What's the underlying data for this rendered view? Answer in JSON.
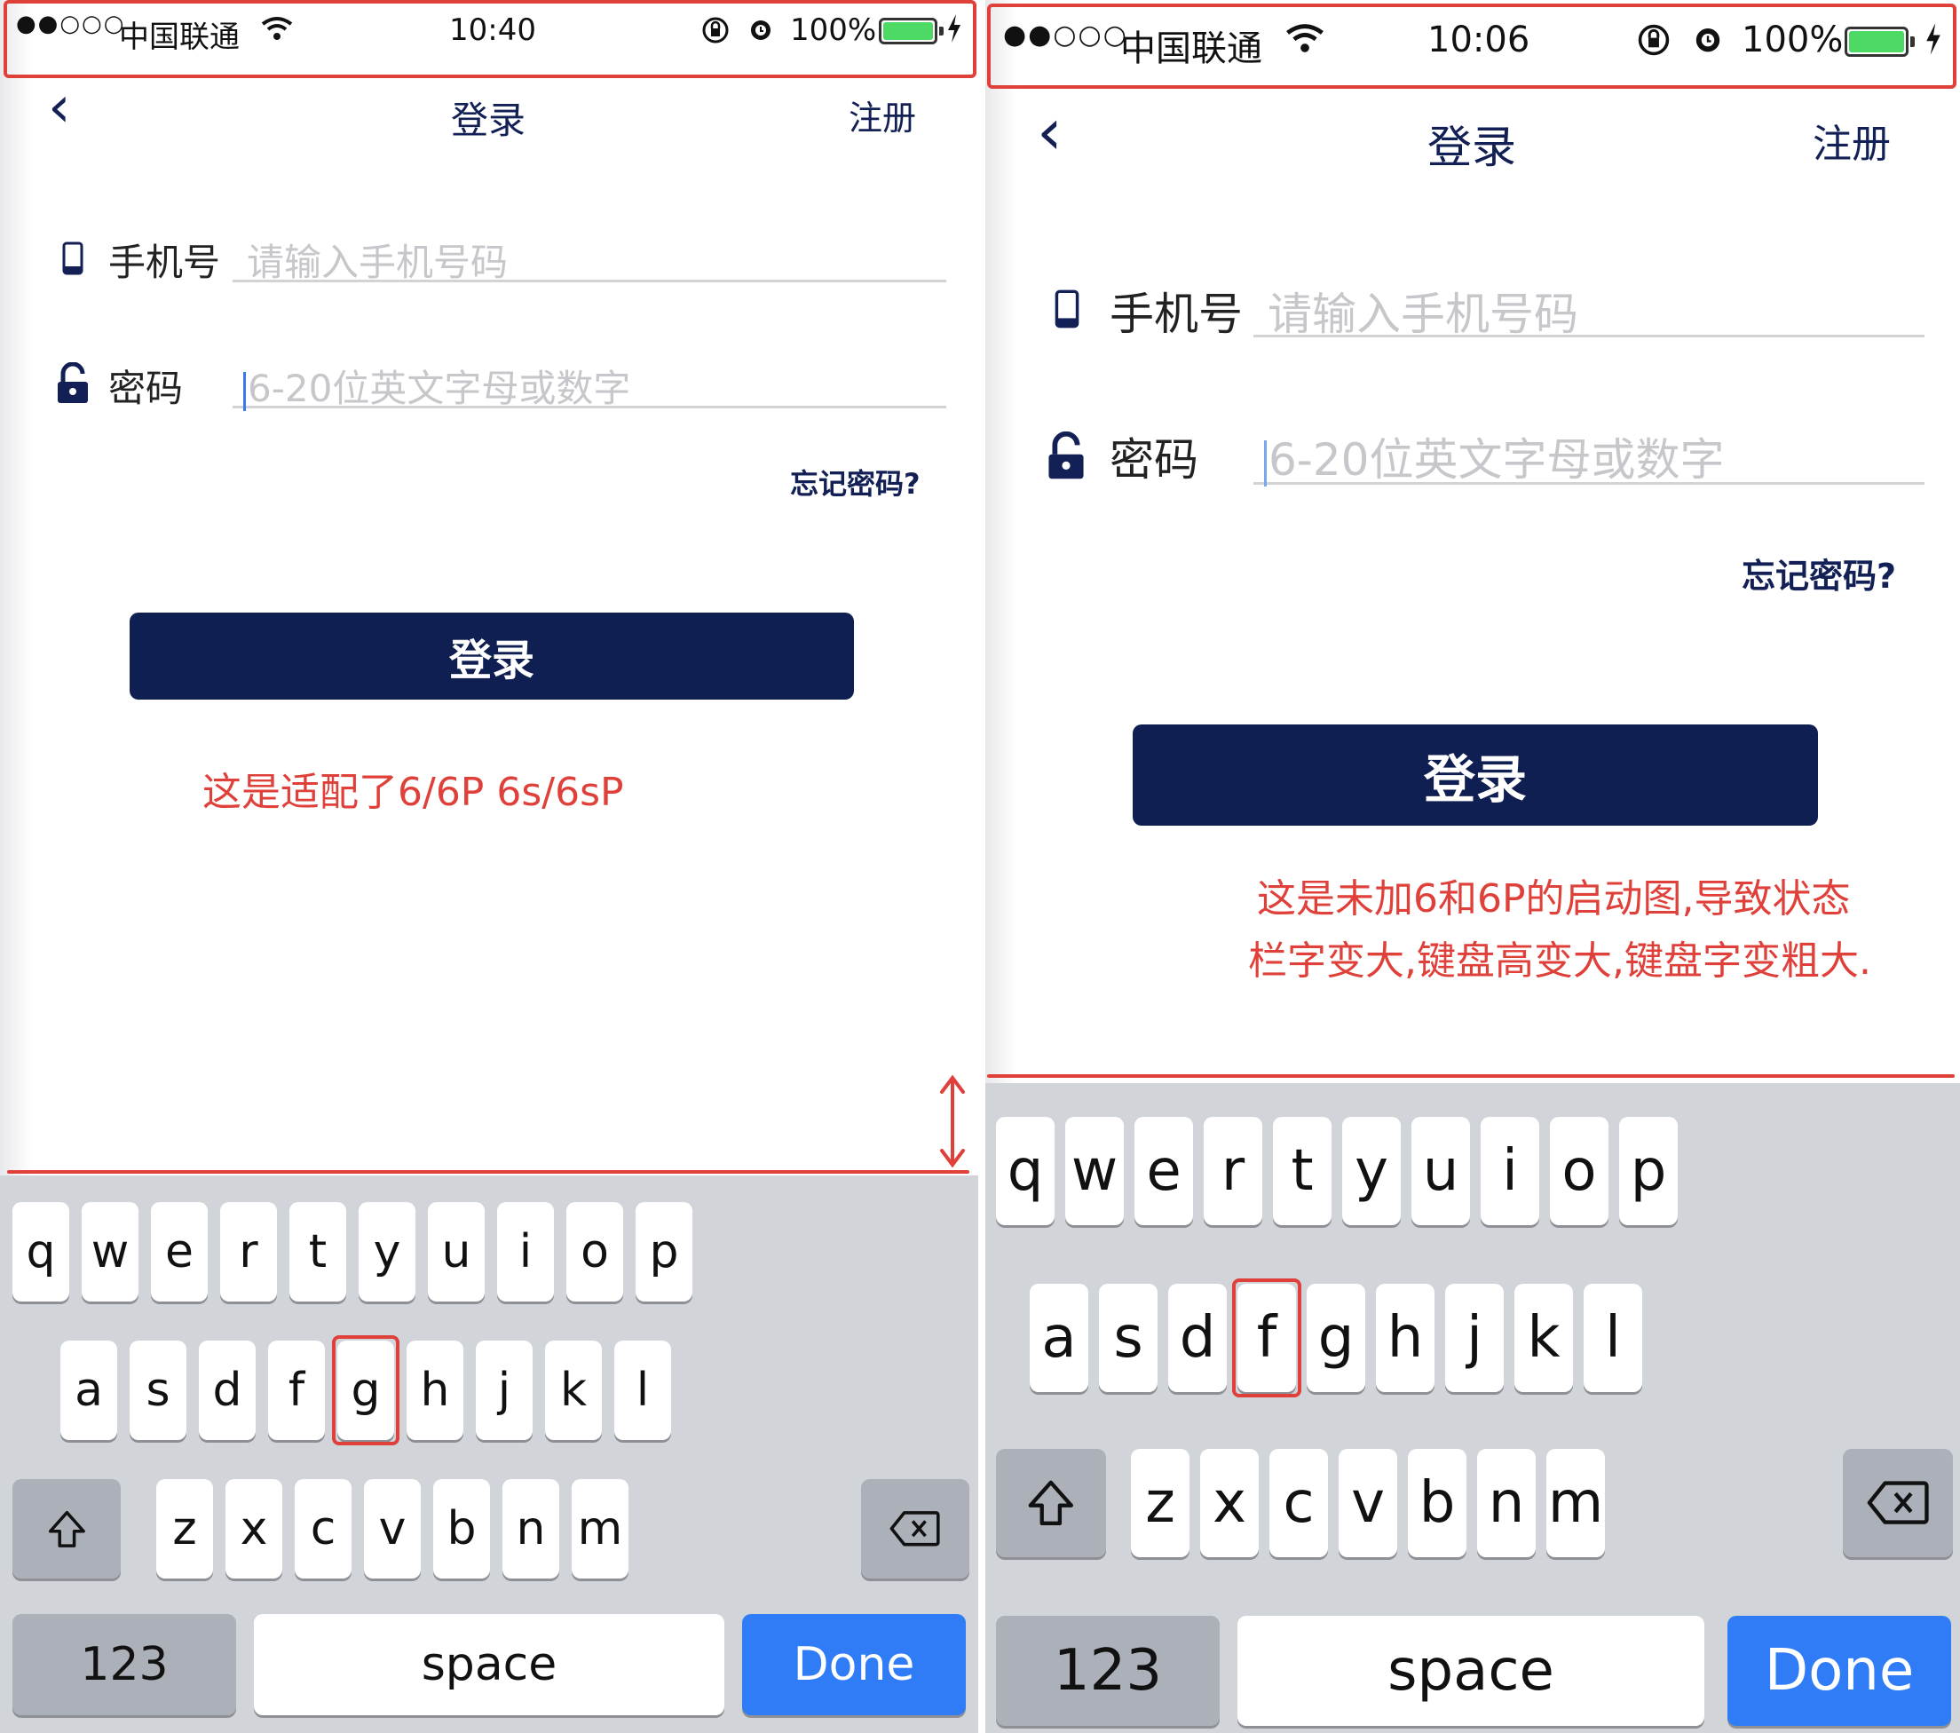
{
  "left": {
    "status": {
      "signal": "●●○○○",
      "carrier": "中国联通",
      "time": "10:40",
      "battery": "100%"
    },
    "nav": {
      "back": "‹",
      "title": "登录",
      "register": "注册"
    },
    "phone_field": {
      "label": "手机号",
      "placeholder": "请输入手机号码"
    },
    "password_field": {
      "label": "密码",
      "placeholder": "6-20位英文字母或数字"
    },
    "forgot": "忘记密码?",
    "login_button": "登录",
    "note": "这是适配了6/6P 6s/6sP",
    "highlighted_key": "g"
  },
  "right": {
    "status": {
      "signal": "●●○○○",
      "carrier": "中国联通",
      "time": "10:06",
      "battery": "100%"
    },
    "nav": {
      "back": "‹",
      "title": "登录",
      "register": "注册"
    },
    "phone_field": {
      "label": "手机号",
      "placeholder": "请输入手机号码"
    },
    "password_field": {
      "label": "密码",
      "placeholder": "6-20位英文字母或数字"
    },
    "forgot": "忘记密码?",
    "login_button": "登录",
    "note_line1": "这是未加6和6P的启动图,导致状态",
    "note_line2": "栏字变大,键盘高变大,键盘字变粗大.",
    "highlighted_key": "f"
  },
  "keyboard": {
    "row1": [
      "q",
      "w",
      "e",
      "r",
      "t",
      "y",
      "u",
      "i",
      "o",
      "p"
    ],
    "row2": [
      "a",
      "s",
      "d",
      "f",
      "g",
      "h",
      "j",
      "k",
      "l"
    ],
    "row3": [
      "z",
      "x",
      "c",
      "v",
      "b",
      "n",
      "m"
    ],
    "numbers": "123",
    "space": "space",
    "done": "Done",
    "shift_icon": "shift-arrow",
    "delete_icon": "delete-backspace"
  },
  "colors": {
    "accent": "#0f1f52",
    "annotation": "#e0403a",
    "done": "#2f7cf6",
    "battery": "#4cd964"
  }
}
